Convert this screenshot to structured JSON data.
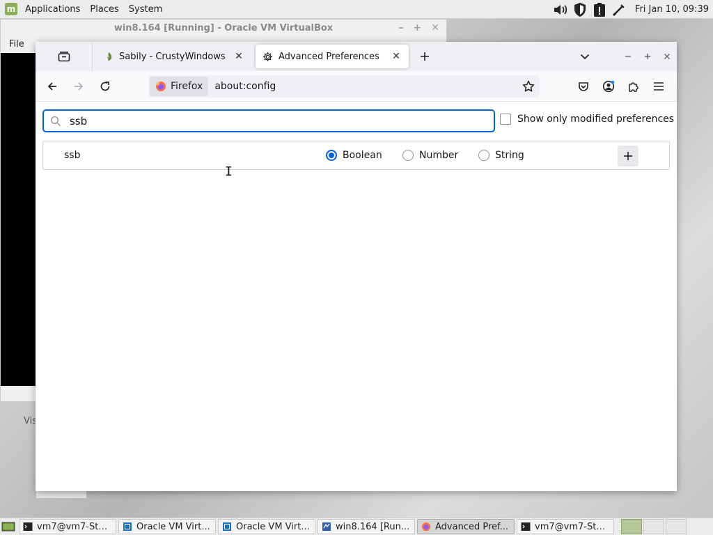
{
  "top_panel": {
    "menus": [
      "Applications",
      "Places",
      "System"
    ],
    "clock": "Fri Jan 10, 09:39"
  },
  "vbox": {
    "title": "win8.164 [Running] - Oracle VM VirtualBox",
    "menu_file": "File",
    "status_text": "Vis"
  },
  "firefox": {
    "tabs": [
      {
        "label": "Sabily - CrustyWindows",
        "active": false
      },
      {
        "label": "Advanced Preferences",
        "active": true
      }
    ],
    "identity_label": "Firefox",
    "url": "about:config",
    "search_value": "ssb",
    "show_modified_label": "Show only modified preferences",
    "pref_row": {
      "name": "ssb",
      "types": [
        "Boolean",
        "Number",
        "String"
      ],
      "selected_type": "Boolean"
    }
  },
  "taskbar": {
    "items": [
      {
        "label": "vm7@vm7-Sta...",
        "icon": "terminal-icon"
      },
      {
        "label": "Oracle VM Virt...",
        "icon": "virtualbox-icon"
      },
      {
        "label": "Oracle VM Virt...",
        "icon": "virtualbox-icon"
      },
      {
        "label": "win8.164 [Run...",
        "icon": "virtualbox-vm-icon"
      },
      {
        "label": "Advanced Pref...",
        "icon": "firefox-icon",
        "active": true
      },
      {
        "label": "vm7@vm7-Sta...",
        "icon": "terminal-icon"
      }
    ]
  },
  "colors": {
    "accent": "#0061e0",
    "mint": "#8bb158"
  }
}
